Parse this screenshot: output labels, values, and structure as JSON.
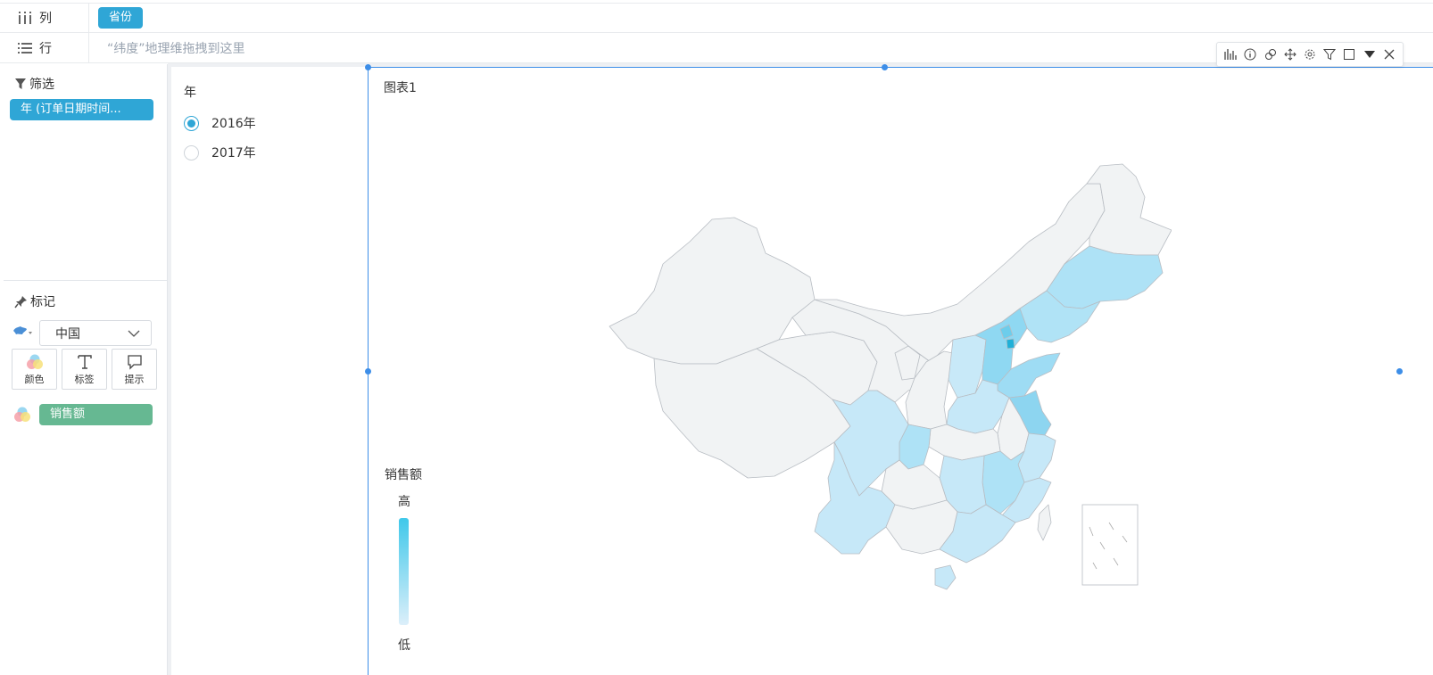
{
  "shelves": {
    "column": {
      "label": "列",
      "field": "省份"
    },
    "row": {
      "label": "行",
      "placeholder": "“纬度”地理维拖拽到这里"
    }
  },
  "left_panel": {
    "filter_title": "筛选",
    "filter_pill": "年 (订单日期时间...",
    "mark_title": "标记",
    "map_select": "中国",
    "mark_buttons": {
      "color": "颜色",
      "label": "标签",
      "tooltip": "提示"
    },
    "measure_pill": "销售额"
  },
  "year_filter": {
    "title": "年",
    "options": [
      {
        "label": "2016年",
        "selected": true
      },
      {
        "label": "2017年",
        "selected": false
      }
    ]
  },
  "chart": {
    "title": "图表1",
    "legend": {
      "title": "销售额",
      "high": "高",
      "low": "低",
      "color_high": "#40c8ea",
      "color_low": "#dceffa"
    },
    "toolbar_icons": [
      "chart-type-icon",
      "info-icon",
      "link-icon",
      "move-icon",
      "settings-icon",
      "filter-icon",
      "maximize-icon",
      "dropdown-icon",
      "close-icon"
    ]
  },
  "colors": {
    "accent_blue": "#2fa6d6",
    "measure_green": "#66b892",
    "selection_border": "#3d8ee8"
  }
}
